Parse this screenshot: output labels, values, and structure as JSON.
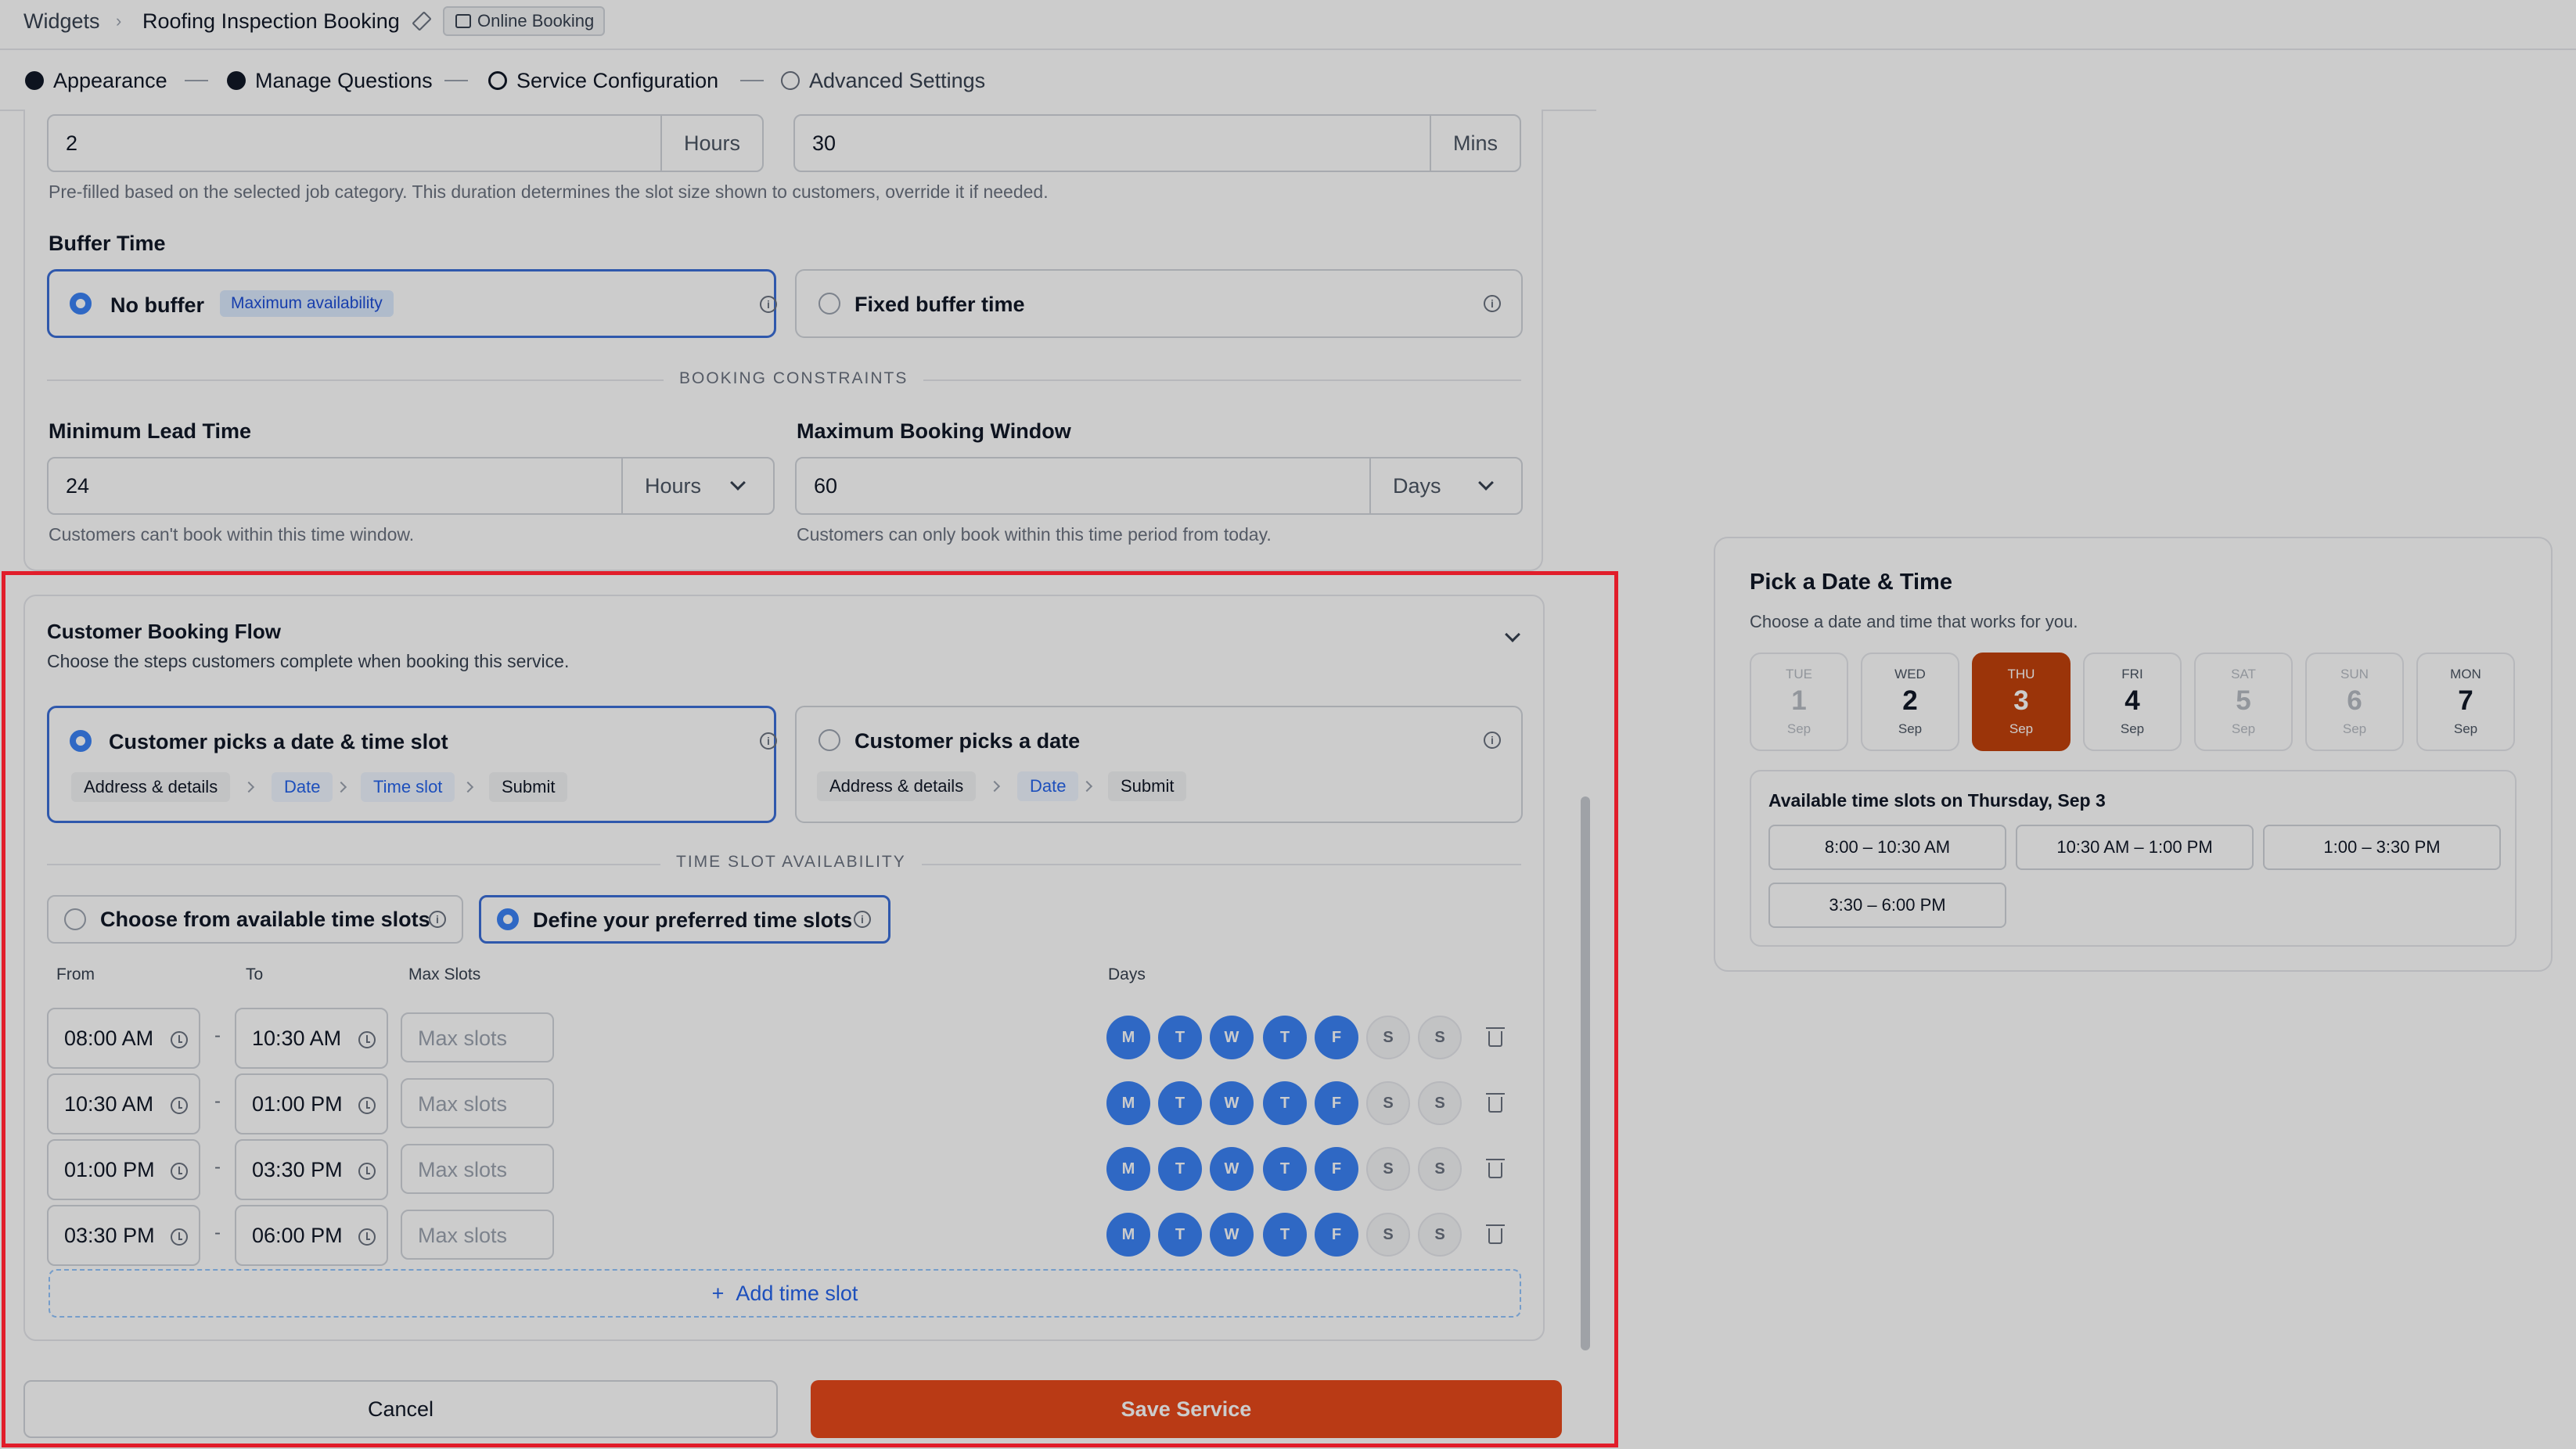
{
  "breadcrumb": {
    "root": "Widgets",
    "current": "Roofing Inspection Booking",
    "badge": "Online Booking"
  },
  "steps": [
    {
      "label": "Appearance",
      "state": "done"
    },
    {
      "label": "Manage Questions",
      "state": "done"
    },
    {
      "label": "Service Configuration",
      "state": "current"
    },
    {
      "label": "Advanced Settings",
      "state": "todo"
    }
  ],
  "duration": {
    "hours_value": "2",
    "hours_unit": "Hours",
    "mins_value": "30",
    "mins_unit": "Mins",
    "help": "Pre-filled based on the selected job category. This duration determines the slot size shown to customers, override it if needed."
  },
  "buffer": {
    "label": "Buffer Time",
    "no_buffer": "No buffer",
    "no_buffer_pill": "Maximum availability",
    "fixed": "Fixed buffer time"
  },
  "constraints": {
    "heading": "BOOKING CONSTRAINTS",
    "lead_label": "Minimum Lead Time",
    "lead_value": "24",
    "lead_unit": "Hours",
    "lead_help": "Customers can't book within this time window.",
    "window_label": "Maximum Booking Window",
    "window_value": "60",
    "window_unit": "Days",
    "window_help": "Customers can only book within this time period from today."
  },
  "flow": {
    "title": "Customer Booking Flow",
    "subtitle": "Choose the steps customers complete when booking this service.",
    "option1": {
      "title": "Customer picks a date & time slot",
      "chips": [
        "Address & details",
        "Date",
        "Time slot",
        "Submit"
      ]
    },
    "option2": {
      "title": "Customer picks a date",
      "chips": [
        "Address & details",
        "Date",
        "Submit"
      ]
    }
  },
  "availability": {
    "heading": "TIME SLOT AVAILABILITY",
    "choose": "Choose from available time slots",
    "define": "Define your preferred time slots",
    "col_from": "From",
    "col_to": "To",
    "col_max": "Max Slots",
    "col_days": "Days",
    "max_placeholder": "Max slots",
    "day_letters": [
      "M",
      "T",
      "W",
      "T",
      "F",
      "S",
      "S"
    ],
    "rows": [
      {
        "from": "08:00 AM",
        "to": "10:30 AM"
      },
      {
        "from": "10:30 AM",
        "to": "01:00 PM"
      },
      {
        "from": "01:00 PM",
        "to": "03:30 PM"
      },
      {
        "from": "03:30 PM",
        "to": "06:00 PM"
      }
    ],
    "active_days": [
      true,
      true,
      true,
      true,
      true,
      false,
      false
    ],
    "add_label": "Add time slot"
  },
  "footer": {
    "cancel": "Cancel",
    "save": "Save Service"
  },
  "preview": {
    "title": "Pick a Date & Time",
    "subtitle": "Choose a date and time that works for you.",
    "days": [
      {
        "dow": "TUE",
        "num": "1",
        "mon": "Sep",
        "state": "disabled"
      },
      {
        "dow": "WED",
        "num": "2",
        "mon": "Sep",
        "state": "normal"
      },
      {
        "dow": "THU",
        "num": "3",
        "mon": "Sep",
        "state": "selected"
      },
      {
        "dow": "FRI",
        "num": "4",
        "mon": "Sep",
        "state": "normal"
      },
      {
        "dow": "SAT",
        "num": "5",
        "mon": "Sep",
        "state": "disabled"
      },
      {
        "dow": "SUN",
        "num": "6",
        "mon": "Sep",
        "state": "disabled"
      },
      {
        "dow": "MON",
        "num": "7",
        "mon": "Sep",
        "state": "normal"
      }
    ],
    "slots_title": "Available time slots on Thursday, Sep 3",
    "slots": [
      "8:00 – 10:30 AM",
      "10:30 AM – 1:00 PM",
      "1:00 – 3:30 PM",
      "3:30 – 6:00 PM"
    ]
  },
  "colors": {
    "accent": "#3b82f6",
    "save": "#e8491b",
    "selected_day": "#c2410c",
    "highlight": "#e11d2a"
  }
}
